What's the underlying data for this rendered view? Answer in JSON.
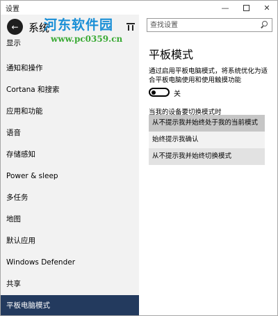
{
  "window": {
    "title": "设置",
    "minimize": "—",
    "close": "✕"
  },
  "left": {
    "back_glyph": "←",
    "section_title": "系统",
    "nav_items": [
      "显示",
      "通知和操作",
      "Cortana 和搜索",
      "应用和功能",
      "语音",
      "存储感知",
      "Power & sleep",
      "多任务",
      "地图",
      "默认应用",
      "Windows Defender",
      "共享",
      "平板电脑模式"
    ],
    "selected_item": "平板电脑模式"
  },
  "right": {
    "search_placeholder": "查找设置",
    "page_title": "平板模式",
    "description": "通过启用平板电脑模式，将系统优化为适合平板电脑使用和使用触摸功能",
    "toggle_state": "关",
    "toggle_on": false,
    "list_label": "当我的设备要切换模式时",
    "options": [
      "从不提示我并始终处于我的当前模式",
      "始终提示我确认",
      "从不提示我并始终切换模式"
    ],
    "selected_option": "从不提示我并始终处于我的当前模式"
  },
  "watermark": {
    "brand": "河东软件园",
    "url": "www.pc0359.cn"
  },
  "colors": {
    "nav_selected_bg": "#233a5e",
    "left_pane_bg": "#f2f2f2",
    "option_selected_bg": "#c6c6c6",
    "watermark_blue": "#1a8fd6",
    "watermark_green": "#3aaa35"
  },
  "icons": {
    "back": "back-arrow-icon",
    "home": "home-icon",
    "search": "search-icon",
    "minimize": "minimize-icon",
    "maximize": "maximize-icon",
    "close": "close-icon"
  }
}
